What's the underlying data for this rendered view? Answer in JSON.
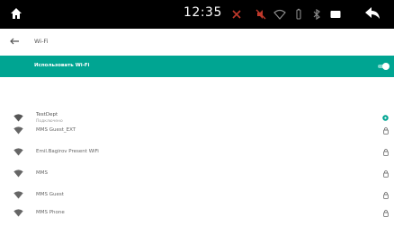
{
  "statusbar": {
    "time": "12:35"
  },
  "header": {
    "title": "Wi-Fi"
  },
  "wifi_toggle": {
    "label": "Использовать Wi-Fi",
    "state": "on"
  },
  "colors": {
    "accent": "#00a592",
    "statusbar": "#000000"
  },
  "networks": [
    {
      "name": "TestDept",
      "status": "Подключено",
      "connected": true
    },
    {
      "name": "MMS Guest_EXT",
      "locked": true
    },
    {
      "name": "Emil.Bagirov Present WiFi",
      "locked": true
    },
    {
      "name": "MMS",
      "locked": true
    },
    {
      "name": "MMS Guest",
      "locked": true
    },
    {
      "name": "MMS Phone",
      "locked": true
    }
  ]
}
